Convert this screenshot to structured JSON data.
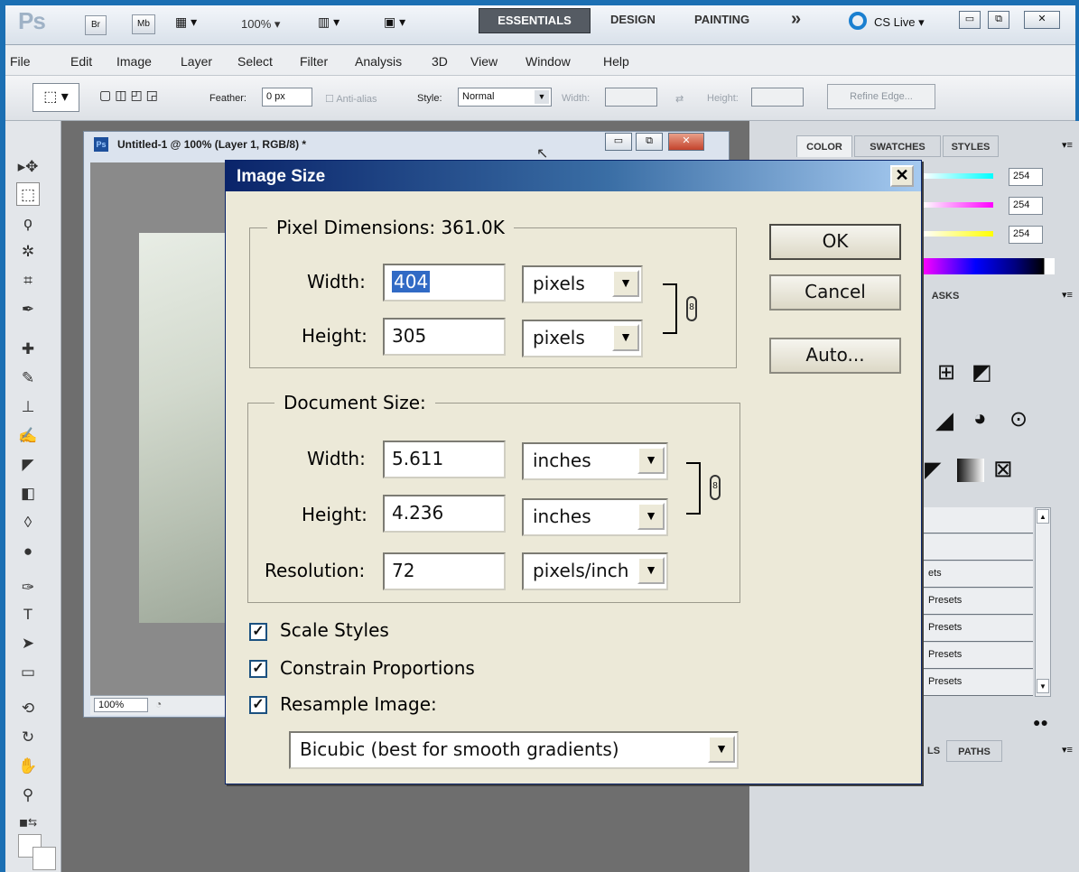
{
  "appbar": {
    "logo": "Ps",
    "bridge": "Br",
    "mini_bridge": "Mb",
    "zoom": "100% ▾",
    "workspaces": [
      "ESSENTIALS",
      "DESIGN",
      "PAINTING"
    ],
    "more": "»",
    "cslive": "CS Live ▾"
  },
  "menubar": {
    "items": [
      "File",
      "Edit",
      "Image",
      "Layer",
      "Select",
      "Filter",
      "Analysis",
      "3D",
      "View",
      "Window",
      "Help"
    ]
  },
  "options": {
    "feather_label": "Feather:",
    "feather_value": "0 px",
    "antialias_label": "Anti-alias",
    "style_label": "Style:",
    "style_value": "Normal",
    "width_label": "Width:",
    "height_label": "Height:",
    "refine_edge": "Refine Edge..."
  },
  "document": {
    "title": "Untitled-1 @ 100% (Layer 1, RGB/8) *",
    "ps_icon": "Ps",
    "zoom": "100%"
  },
  "panels": {
    "tabs": [
      "COLOR",
      "SWATCHES",
      "STYLES"
    ],
    "slider_values": [
      "254",
      "254",
      "254"
    ],
    "masks_tab": "ASKS",
    "presets": [
      "",
      "",
      "ets",
      "Presets",
      "Presets",
      "Presets",
      "Presets"
    ],
    "paths_tabs": [
      "LS",
      "PATHS"
    ]
  },
  "dialog": {
    "title": "Image Size",
    "close": "✕",
    "pixel_dimensions": {
      "legend": "Pixel Dimensions:  361.0K",
      "width_label": "Width:",
      "width_value": "404",
      "width_unit": "pixels",
      "height_label": "Height:",
      "height_value": "305",
      "height_unit": "pixels"
    },
    "document_size": {
      "legend": "Document Size:",
      "width_label": "Width:",
      "width_value": "5.611",
      "width_unit": "inches",
      "height_label": "Height:",
      "height_value": "4.236",
      "height_unit": "inches",
      "resolution_label": "Resolution:",
      "resolution_value": "72",
      "resolution_unit": "pixels/inch"
    },
    "buttons": {
      "ok": "OK",
      "cancel": "Cancel",
      "auto": "Auto..."
    },
    "checkboxes": {
      "scale_styles": "Scale Styles",
      "constrain": "Constrain Proportions",
      "resample": "Resample Image:"
    },
    "resample_method": "Bicubic (best for smooth gradients)"
  },
  "colors": {
    "desktop": "#1b6fb3",
    "dialog_bg": "#ece9d8",
    "titlebar_start": "#0a246a",
    "titlebar_end": "#a6caf0"
  }
}
